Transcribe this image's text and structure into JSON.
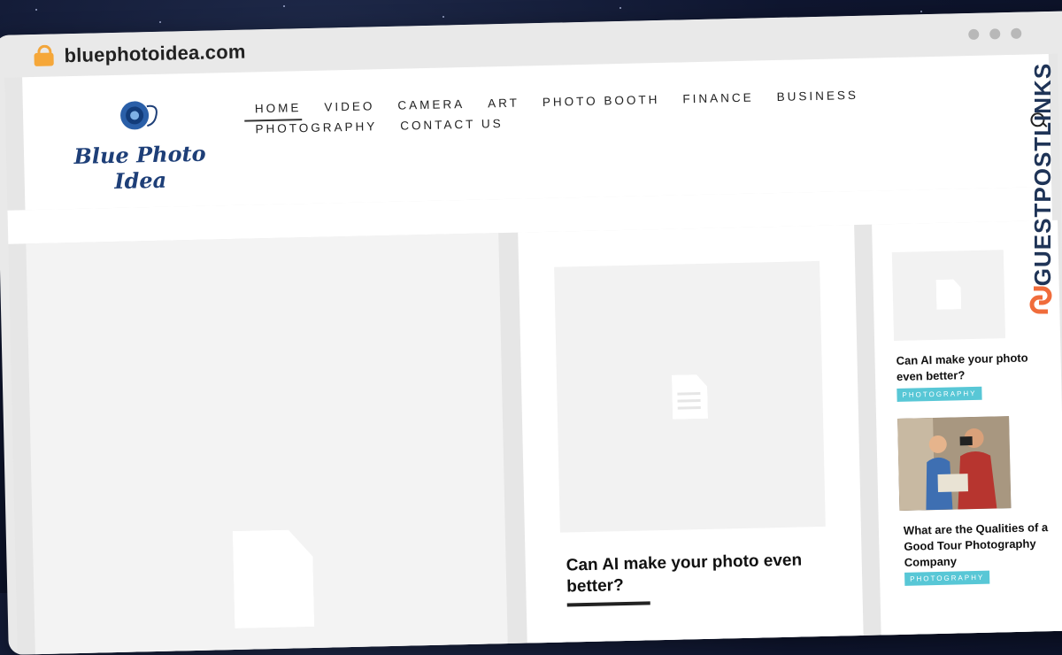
{
  "browser": {
    "url": "bluephotoidea.com",
    "lock_icon": "lock-icon"
  },
  "site": {
    "logo_text": "Blue Photo Idea",
    "nav": {
      "row1": [
        "HOME",
        "VIDEO",
        "CAMERA",
        "ART",
        "PHOTO BOOTH",
        "FINANCE",
        "BUSINESS"
      ],
      "row2": [
        "PHOTOGRAPHY",
        "CONTACT US"
      ],
      "active": "HOME"
    }
  },
  "featured": {
    "title": "Can AI make your photo even better?"
  },
  "sidebar": {
    "items": [
      {
        "title": "Can AI make your photo even better?",
        "category": "PHOTOGRAPHY"
      },
      {
        "title": "What are the Qualities of a Good Tour Photography Company",
        "category": "PHOTOGRAPHY"
      }
    ]
  },
  "brand": {
    "text": "GUESTPOSTLINKS"
  },
  "colors": {
    "accent_badge": "#58c7d6",
    "logo_blue": "#1e3f78",
    "brand_orange": "#f06c3b",
    "brand_navy": "#1f3457"
  }
}
